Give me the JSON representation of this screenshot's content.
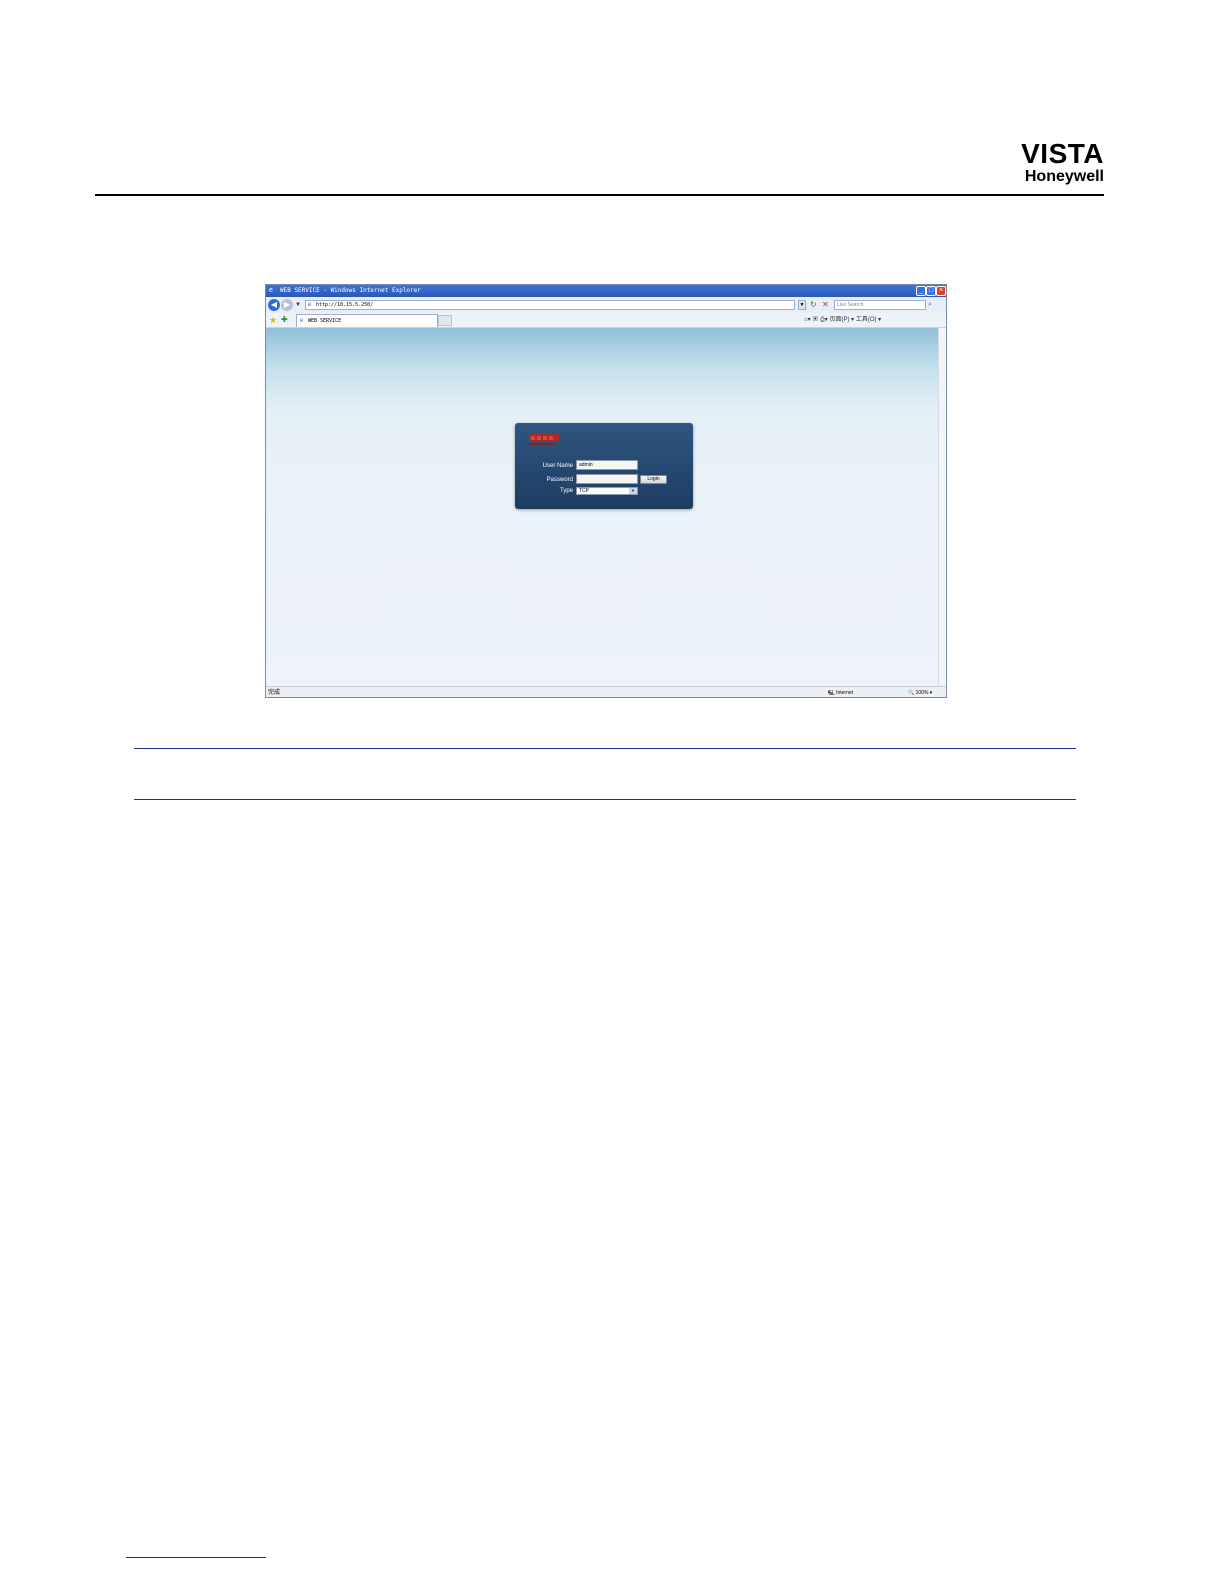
{
  "header": {
    "brand": "VISTA",
    "subbrand": "Honeywell"
  },
  "browser": {
    "window_title": "WEB SERVICE - Windows Internet Explorer",
    "address": "http://10.15.5.250/",
    "search_placeholder": "Live Search",
    "tab_label": "WEB SERVICE",
    "command_bar": "页面(P) ▾ 工具(O) ▾",
    "status_left": "完成",
    "status_zone": "Internet",
    "status_zoom": "100%"
  },
  "login": {
    "username_label": "User Name",
    "username_value": "admin",
    "password_label": "Password",
    "login_button": "Login",
    "type_label": "Type",
    "type_value": "TCP"
  },
  "colors": {
    "panel_top": "#2e5680",
    "panel_bottom": "#1d3c62",
    "rule": "#1f2f8a"
  }
}
